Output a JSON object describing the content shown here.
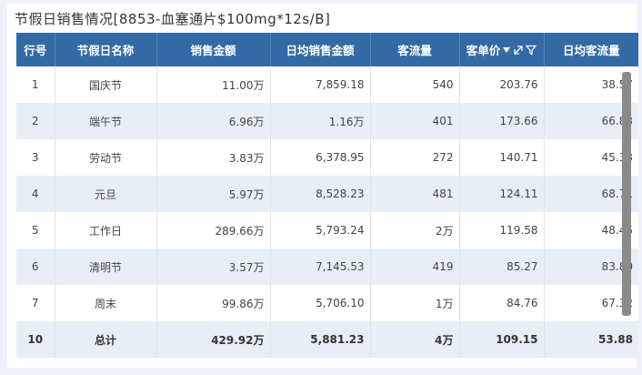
{
  "title": "节假日销售情况[8853-血塞通片$100mg*12s/B]",
  "columns": [
    "行号",
    "节假日名称",
    "销售金额",
    "日均销售金额",
    "客流量",
    "客单价",
    "日均客流量"
  ],
  "rows": [
    {
      "no": "1",
      "name": "国庆节",
      "sales": "11.00万",
      "daily_sales": "7,859.18",
      "traffic": "540",
      "unit_price": "203.76",
      "daily_traffic": "38.57"
    },
    {
      "no": "2",
      "name": "端午节",
      "sales": "6.96万",
      "daily_sales": "1.16万",
      "traffic": "401",
      "unit_price": "173.66",
      "daily_traffic": "66.83"
    },
    {
      "no": "3",
      "name": "劳动节",
      "sales": "3.83万",
      "daily_sales": "6,378.95",
      "traffic": "272",
      "unit_price": "140.71",
      "daily_traffic": "45.33"
    },
    {
      "no": "4",
      "name": "元旦",
      "sales": "5.97万",
      "daily_sales": "8,528.23",
      "traffic": "481",
      "unit_price": "124.11",
      "daily_traffic": "68.71"
    },
    {
      "no": "5",
      "name": "工作日",
      "sales": "289.66万",
      "daily_sales": "5,793.24",
      "traffic": "2万",
      "unit_price": "119.58",
      "daily_traffic": "48.45"
    },
    {
      "no": "6",
      "name": "清明节",
      "sales": "3.57万",
      "daily_sales": "7,145.53",
      "traffic": "419",
      "unit_price": "85.27",
      "daily_traffic": "83.80"
    },
    {
      "no": "7",
      "name": "周末",
      "sales": "99.86万",
      "daily_sales": "5,706.10",
      "traffic": "1万",
      "unit_price": "84.76",
      "daily_traffic": "67.32"
    }
  ],
  "total": {
    "no": "10",
    "name": "总计",
    "sales": "429.92万",
    "daily_sales": "5,881.23",
    "traffic": "4万",
    "unit_price": "109.15",
    "daily_traffic": "53.88"
  },
  "icons": {
    "sort": "sort-desc-icon",
    "expand": "expand-icon",
    "filter": "filter-icon"
  },
  "colors": {
    "header_bg": "#336aa6",
    "row_alt": "#e8eef6",
    "scrollbar": "#8a8a8a"
  }
}
